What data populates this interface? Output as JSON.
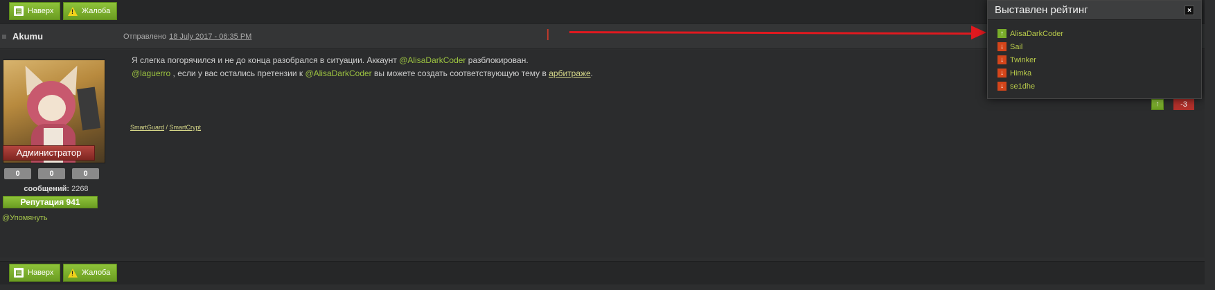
{
  "toolbar": {
    "up_label": "Наверх",
    "report_label": "Жалоба"
  },
  "post": {
    "author": "Akumu",
    "posted_prefix": "Отправлено",
    "posted_date": "18 July 2017 - 06:35 PM",
    "line1_a": "Я слегка погорячился и не до конца разобрался в ситуации. Аккаунт ",
    "line1_nick": "@AlisaDarkCoder",
    "line1_b": " разблокирован.",
    "line2_nick1": "@laguerro",
    "line2_a": " , если у вас остались претензии к ",
    "line2_nick2": "@AlisaDarkCoder",
    "line2_b": " вы можете создать соответствующую тему в ",
    "line2_link": "арбитраже",
    "line2_end": ".",
    "signature_a": "SmartGuard",
    "signature_sep": " / ",
    "signature_b": "SmartCrypt",
    "vote_up": "↑",
    "vote_score": "-3"
  },
  "profile": {
    "role": "Администратор",
    "counters": [
      "0",
      "0",
      "0"
    ],
    "messages_label": "сообщений:",
    "messages_count": "2268",
    "reputation": "Репутация 941",
    "mention": "@Упомянуть"
  },
  "rating_popup": {
    "title": "Выставлен рейтинг",
    "close": "×",
    "items": [
      {
        "name": "AlisaDarkCoder",
        "vote": "up",
        "glyph": "↑"
      },
      {
        "name": "Sail",
        "vote": "down",
        "glyph": "↓"
      },
      {
        "name": "Twinker",
        "vote": "down",
        "glyph": "↓"
      },
      {
        "name": "Himka",
        "vote": "down",
        "glyph": "↓"
      },
      {
        "name": "se1dhe",
        "vote": "down",
        "glyph": "↓"
      }
    ]
  },
  "colors": {
    "accent_green": "#79ad2a",
    "negative_red": "#d4451a",
    "annotation_arrow": "#e0191f"
  }
}
